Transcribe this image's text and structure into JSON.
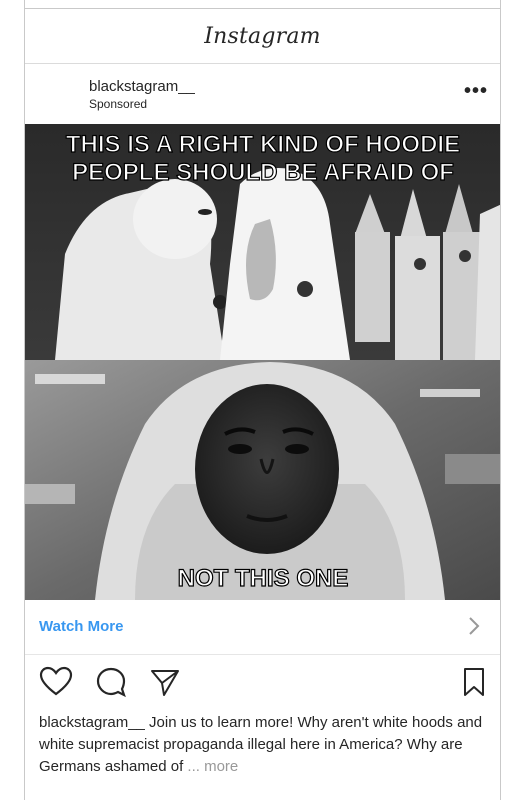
{
  "app": {
    "title": "Instagram"
  },
  "post": {
    "username": "blackstagram__",
    "sponsored_label": "Sponsored",
    "more_options": "•••",
    "meme_top_line1": "THIS IS A RIGHT KIND OF HOODIE",
    "meme_top_line2": "PEOPLE SHOULD BE AFRAID OF",
    "meme_bottom": "NOT THIS ONE",
    "cta_label": "Watch More",
    "caption_user": "blackstagram__",
    "caption_text": " Join us to learn more! Why aren't white hoods and white supremacist propaganda illegal here in America? Why are Germans ashamed of ",
    "caption_more": "... more"
  },
  "icons": {
    "like": "heart-icon",
    "comment": "comment-icon",
    "share": "send-icon",
    "save": "bookmark-icon",
    "options": "more-options-icon",
    "cta_arrow": "chevron-right-icon"
  },
  "colors": {
    "link": "#3897f0",
    "text": "#262626",
    "muted": "#999999"
  }
}
